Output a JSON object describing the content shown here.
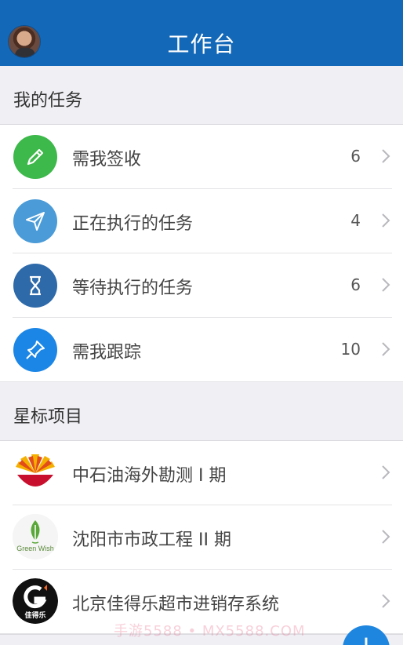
{
  "header": {
    "title": "工作台"
  },
  "my_tasks": {
    "heading": "我的任务",
    "items": [
      {
        "label": "需我签收",
        "count": "6",
        "icon": "pencil-icon",
        "color": "#3db84a"
      },
      {
        "label": "正在执行的任务",
        "count": "4",
        "icon": "paper-plane-icon",
        "color": "#4a9bd8"
      },
      {
        "label": "等待执行的任务",
        "count": "6",
        "icon": "hourglass-icon",
        "color": "#2e6aaa"
      },
      {
        "label": "需我跟踪",
        "count": "10",
        "icon": "pin-icon",
        "color": "#1c86e6"
      }
    ]
  },
  "starred_projects": {
    "heading": "星标项目",
    "items": [
      {
        "label": "中石油海外勘测 I 期",
        "logo": "cnpc-logo"
      },
      {
        "label": "沈阳市市政工程 II 期",
        "logo": "green-wish-logo",
        "logo_text": "Green Wish"
      },
      {
        "label": "北京佳得乐超市进销存系统",
        "logo": "gatorade-logo",
        "logo_text": "佳得乐"
      }
    ]
  },
  "watermark": "手游5588 • MX5588.COM",
  "fab": {
    "symbol": "+"
  }
}
